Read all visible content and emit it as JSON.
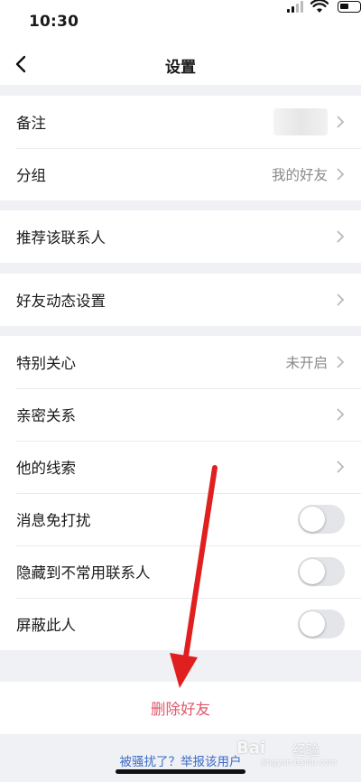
{
  "status_bar": {
    "time": "10:30",
    "battery_level": 0.45
  },
  "nav": {
    "title": "设置",
    "back_icon": "chevron-left-icon"
  },
  "groups": {
    "basic": {
      "remark_label": "备注",
      "group_label": "分组",
      "group_value": "我的好友"
    },
    "recommend": {
      "label": "推荐该联系人"
    },
    "moments": {
      "label": "好友动态设置"
    },
    "special": {
      "special_care_label": "特别关心",
      "special_care_value": "未开启",
      "intimacy_label": "亲密关系",
      "clues_label": "他的线索",
      "do_not_disturb_label": "消息免打扰",
      "do_not_disturb_on": false,
      "hide_label": "隐藏到不常用联系人",
      "hide_on": false,
      "block_label": "屏蔽此人",
      "block_on": false
    }
  },
  "delete": {
    "label": "删除好友",
    "color": "#e0566b"
  },
  "report_link": "被骚扰了？举报该用户",
  "watermark": {
    "brand": "Bai",
    "suffix": "经验",
    "url": "jingyan.baidu.com"
  },
  "colors": {
    "background": "#f0f1f5",
    "annotation_arrow": "#e02020",
    "link": "#3b6bc4"
  }
}
